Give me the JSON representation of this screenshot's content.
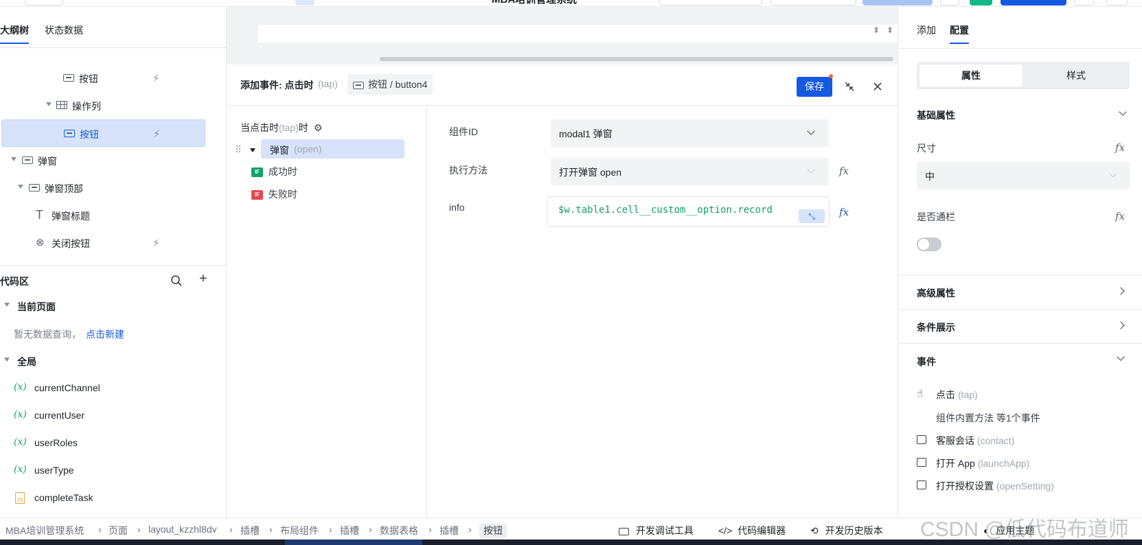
{
  "app": {
    "title": "MBA培训管理系统"
  },
  "left_panel": {
    "tabs": [
      "大纲树",
      "状态数据"
    ],
    "tree": [
      {
        "label": "按钮"
      },
      {
        "label": "操作列"
      },
      {
        "label": "按钮"
      },
      {
        "label": "弹窗"
      },
      {
        "label": "弹窗顶部"
      },
      {
        "label": "弹窗标题"
      },
      {
        "label": "关闭按钮"
      }
    ],
    "code_area": {
      "title": "代码区",
      "current_page": "当前页面",
      "empty_text": "暂无数据查询，",
      "new_link": "点击新建",
      "global": "全局",
      "vars": [
        "currentChannel",
        "currentUser",
        "userRoles",
        "userType",
        "completeTask"
      ],
      "var_symbol": "(x)"
    }
  },
  "event_panel": {
    "title": "添加事件: 点击时",
    "title_suffix": "(tap)",
    "component_tag": "按钮 / button4",
    "save": "保存",
    "trigger_label": "当点击时",
    "trigger_suffix": "(tap)",
    "trigger_end": "时",
    "action_label": "弹窗",
    "action_suffix": "(open)",
    "success": "成功时",
    "failure": "失败时",
    "if_badge": "IF",
    "fields": {
      "component_id_label": "组件ID",
      "component_id_value": "modal1 弹窗",
      "method_label": "执行方法",
      "method_value": "打开弹窗 open",
      "info_label": "info",
      "info_value": "$w.table1.cell__custom__option.record"
    }
  },
  "right_panel": {
    "tabs": [
      "添加",
      "配置"
    ],
    "segments": [
      "属性",
      "样式"
    ],
    "basic": "基础属性",
    "size_label": "尺寸",
    "size_value": "中",
    "full_width_label": "是否通栏",
    "advanced": "高级属性",
    "conditional": "条件展示",
    "events": "事件",
    "event_items": [
      {
        "name": "点击",
        "code": "(tap)"
      },
      {
        "name": "组件内置方法 等1个事件",
        "code": ""
      },
      {
        "name": "客服会话",
        "code": "(contact)"
      },
      {
        "name": "打开 App",
        "code": "(launchApp)"
      },
      {
        "name": "打开授权设置",
        "code": "(openSetting)"
      }
    ]
  },
  "footer": {
    "breadcrumb": [
      "MBA培训管理系统",
      "页面",
      "layout_kzzhl8dv",
      "插槽",
      "布局组件",
      "插槽",
      "数据表格",
      "插槽",
      "按钮"
    ],
    "tools": [
      "开发调试工具",
      "代码编辑器",
      "开发历史版本",
      "应用主题"
    ],
    "watermark": "CSDN @低代码布道师"
  },
  "colors": {
    "accent": "#1459e0",
    "selected_bg": "#d6e3fa",
    "success": "#0fa77a",
    "danger": "#e5484d"
  }
}
